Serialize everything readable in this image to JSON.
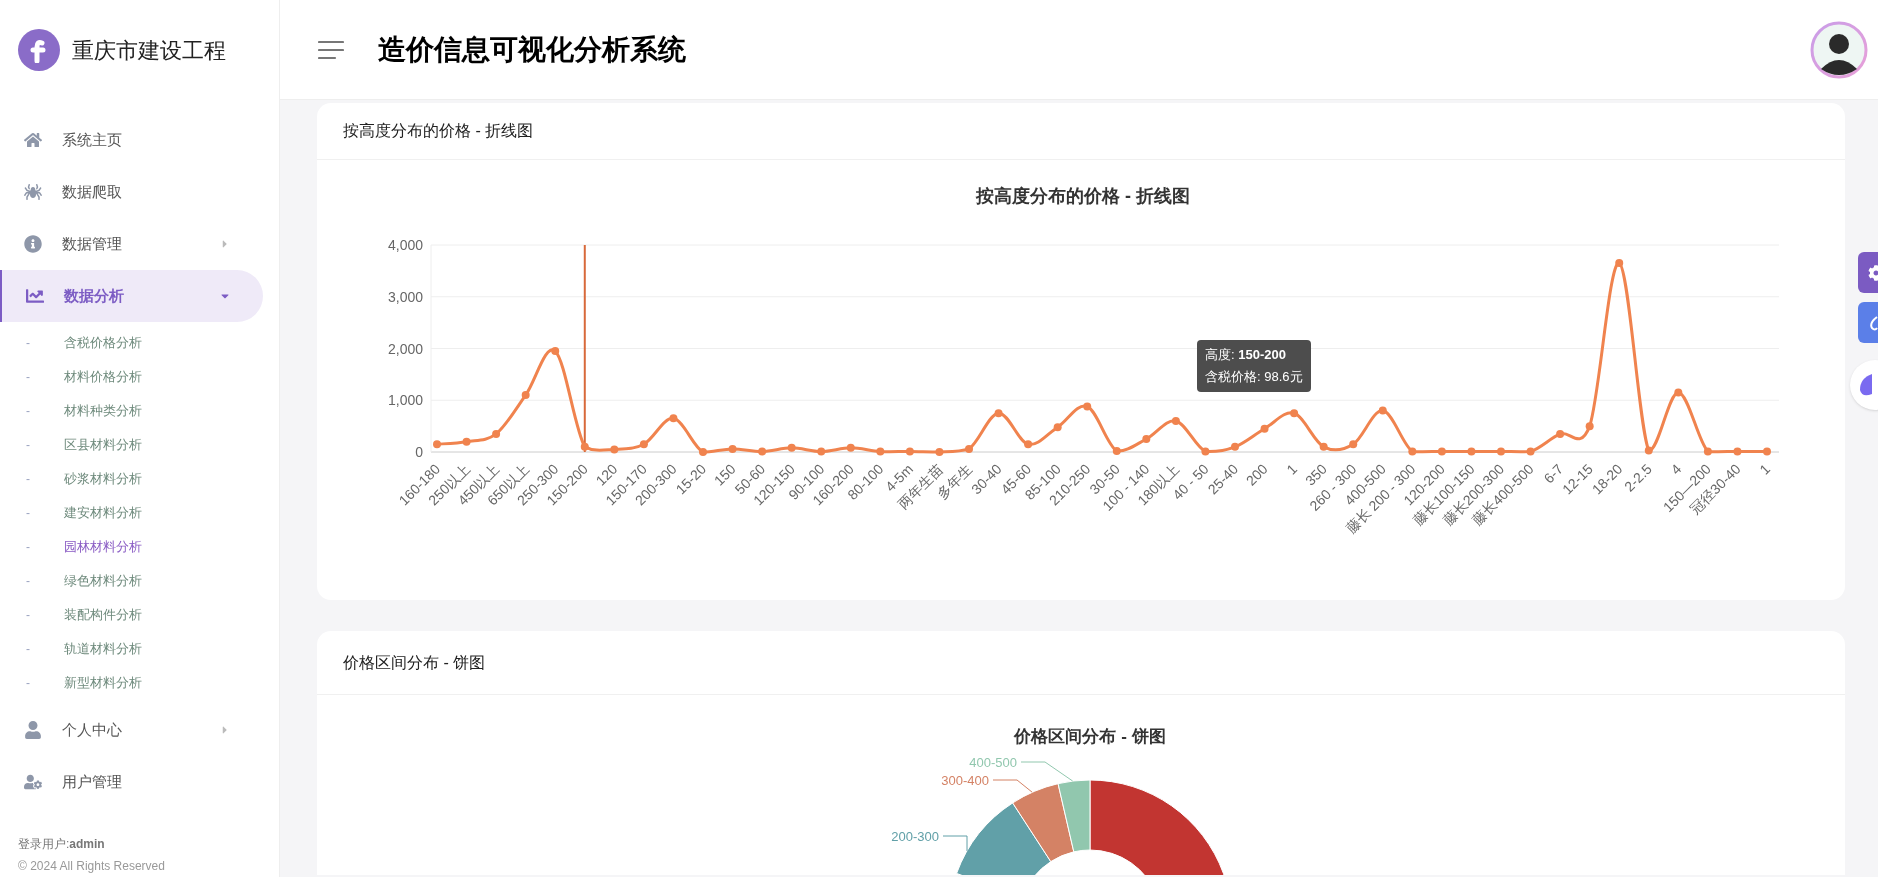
{
  "sidebar": {
    "brand": "重庆市建设工程",
    "items": [
      {
        "kind": "link",
        "label": "系统主页",
        "selected": false
      },
      {
        "kind": "link",
        "label": "数据爬取",
        "selected": false
      },
      {
        "kind": "group",
        "label": "数据管理",
        "selected": false,
        "expanded": false
      },
      {
        "kind": "group",
        "label": "数据分析",
        "selected": true,
        "expanded": true,
        "children": [
          {
            "bullet": "-",
            "label": "含税价格分析",
            "selected": false
          },
          {
            "bullet": "-",
            "label": "材料价格分析",
            "selected": false
          },
          {
            "bullet": "-",
            "label": "材料种类分析",
            "selected": false
          },
          {
            "bullet": "-",
            "label": "区县材料分析",
            "selected": false
          },
          {
            "bullet": "-",
            "label": "砂浆材料分析",
            "selected": false
          },
          {
            "bullet": "-",
            "label": "建安材料分析",
            "selected": false
          },
          {
            "bullet": "-",
            "label": "园林材料分析",
            "selected": true
          },
          {
            "bullet": "-",
            "label": "绿色材料分析",
            "selected": false
          },
          {
            "bullet": "-",
            "label": "装配构件分析",
            "selected": false
          },
          {
            "bullet": "-",
            "label": "轨道材料分析",
            "selected": false
          },
          {
            "bullet": "-",
            "label": "新型材料分析",
            "selected": false
          }
        ]
      },
      {
        "kind": "group",
        "label": "个人中心",
        "selected": false,
        "expanded": false
      },
      {
        "kind": "link",
        "label": "用户管理",
        "selected": false
      }
    ],
    "login_user": "登录用户:**admin**",
    "copyright": "© 2024 All Rights Reserved"
  },
  "header": {
    "title": "造价信息可视化分析系统"
  },
  "line_card": {
    "heading": "按高度分布的价格 - 折线图",
    "chart_data": {
      "type": "line",
      "title": "按高度分布的价格 - 折线图",
      "categories": [
        "160-180",
        "250以上",
        "450以上",
        "650以上",
        "250-300",
        "150-200",
        "120",
        "150-170",
        "200-300",
        "15-20",
        "150",
        "50-60",
        "120-150",
        "90-100",
        "160-200",
        "80-100",
        "4-5m",
        "两年生苗",
        "多年生",
        "30-40",
        "45-60",
        "85-100",
        "210-250",
        "30-50",
        "100 - 140",
        "180以上",
        "40 - 50",
        "25-40",
        "200",
        "1",
        "350",
        "260 - 300",
        "400-500",
        "藤长 200 - 300",
        "120-200",
        "藤长100-150",
        "藤长200-300",
        "藤长400-500",
        "6-7",
        "12-15",
        "18-20",
        "2-2.5",
        "4",
        "150—200",
        "冠径30-40",
        "1"
      ],
      "series": [
        {
          "name": "含税价格",
          "color": "#f0834e",
          "marker": true,
          "values": [
            150,
            200,
            350,
            1100,
            1950,
            100,
            50,
            150,
            650,
            0,
            60,
            10,
            80,
            10,
            80,
            10,
            10,
            0,
            60,
            750,
            150,
            480,
            880,
            20,
            250,
            600,
            10,
            100,
            450,
            750,
            100,
            150,
            800,
            10,
            10,
            10,
            10,
            10,
            350,
            500,
            3650,
            30,
            1150,
            10,
            10,
            10
          ]
        }
      ],
      "grid": true,
      "ref_lines": [
        {
          "axis": "x",
          "value": "150-200",
          "color": "#d8693a"
        }
      ],
      "ylim": [
        0,
        4000
      ],
      "yticks": [
        {
          "value": 0,
          "label": "0"
        },
        {
          "value": 1000,
          "label": "1,000"
        },
        {
          "value": 2000,
          "label": "2,000"
        },
        {
          "value": 3000,
          "label": "3,000"
        },
        {
          "value": 4000,
          "label": "4,000"
        }
      ]
    },
    "tooltip": {
      "title": "高度: **150-200**",
      "value": ": 98.6元"
    }
  },
  "pie_card": {
    "heading": "价格区间分布 - 饼图",
    "title": "价格区间分布 - 饼图",
    "slices": [
      {
        "color": "#c23531"
      },
      {
        "label": "200-300",
        "color": "#61a0a8"
      },
      {
        "label": "300-400",
        "color": "#d48265"
      },
      {
        "label": "400-500",
        "color": "#91c7ae"
      }
    ]
  }
}
